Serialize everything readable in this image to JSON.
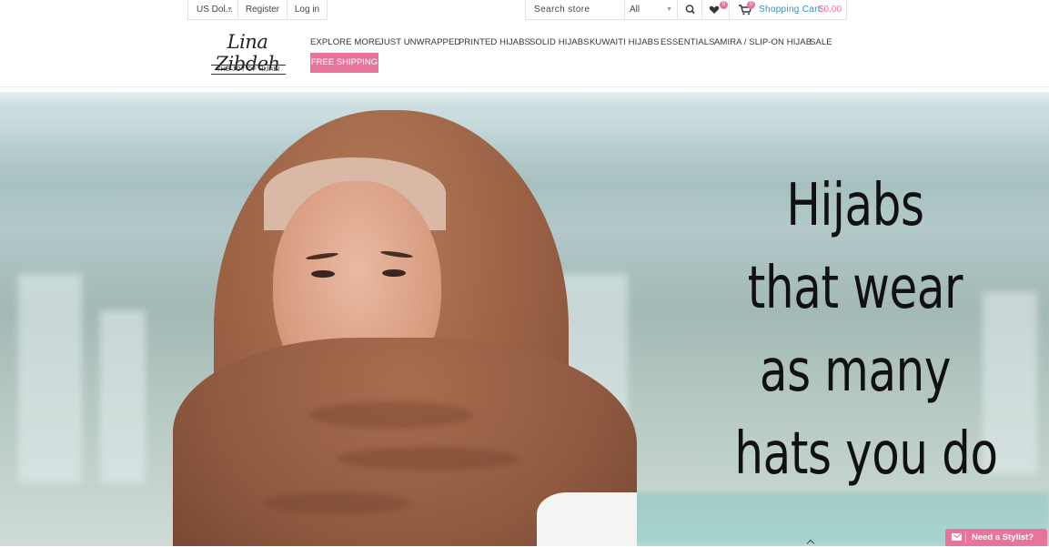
{
  "topbar": {
    "currency": "US Dol...",
    "register": "Register",
    "login": "Log in",
    "search_placeholder": "Search store",
    "category": "All",
    "wishlist_count": "0",
    "cart_count": "0",
    "cart_label": "Shopping Cart",
    "cart_total": "$0.00"
  },
  "logo": {
    "script": "Lina Zibdeh",
    "tagline": "THE JOY OF HIJAB!"
  },
  "nav": {
    "items": [
      "EXPLORE MORE",
      "JUST UNWRAPPED",
      "PRINTED HIJABS",
      "SOLID HIJABS",
      "KUWAITI HIJABS",
      "ESSENTIALS",
      "AMIRA / SLIP-ON HIJAB",
      "SALE"
    ],
    "promo": "FREE SHIPPING"
  },
  "hero": {
    "lines": [
      "Hijabs",
      "that wear",
      "as many",
      "hats you do"
    ]
  },
  "widget": {
    "label": "Need a Stylist?"
  },
  "colors": {
    "accent_pink": "#e8739c",
    "link_blue": "#2a8fc9"
  }
}
